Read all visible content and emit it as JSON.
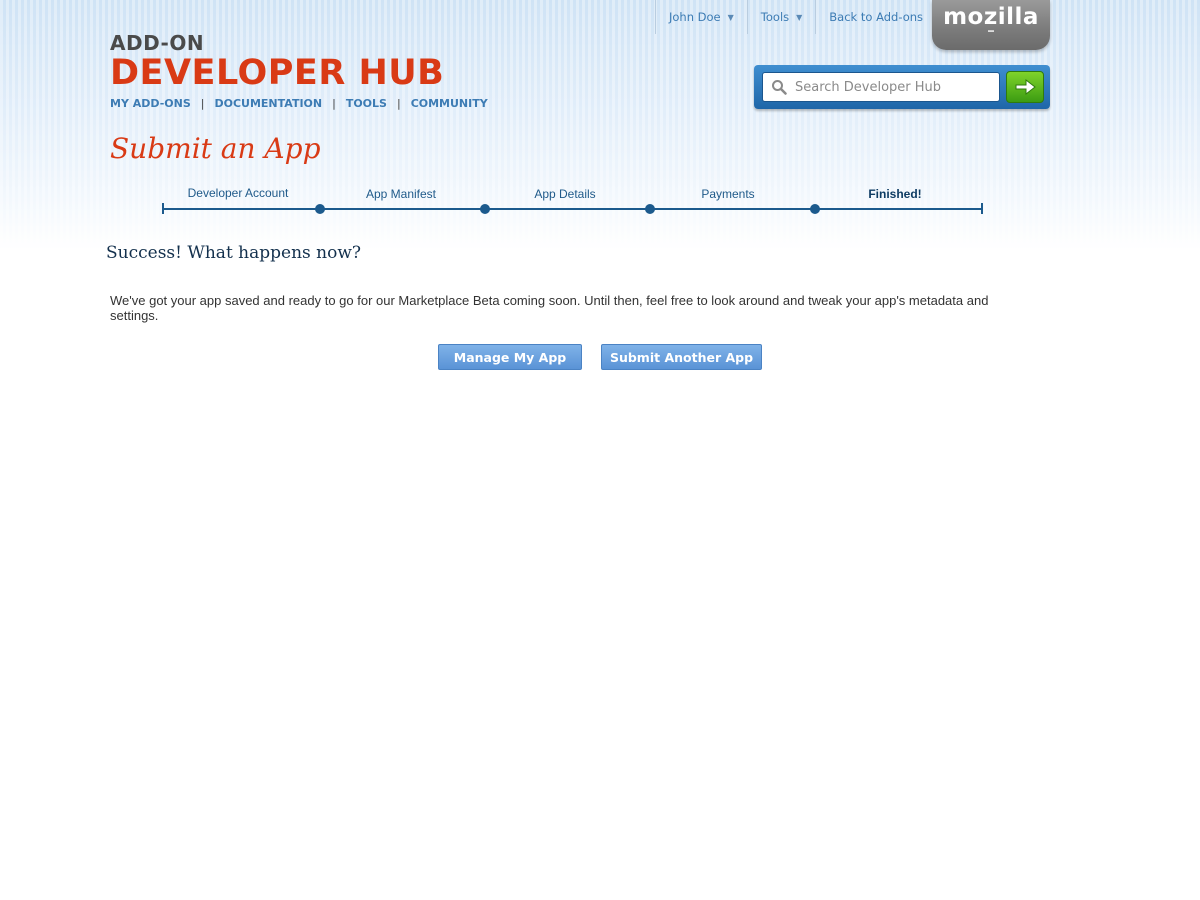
{
  "topnav": {
    "user": "John Doe",
    "tools": "Tools",
    "back": "Back to Add-ons",
    "brand": "mozilla"
  },
  "logo": {
    "line1": "ADD-ON",
    "line2": "DEVELOPER HUB"
  },
  "subnav": {
    "items": [
      "MY ADD-ONS",
      "DOCUMENTATION",
      "TOOLS",
      "COMMUNITY"
    ],
    "separator": "|"
  },
  "search": {
    "placeholder": "Search Developer Hub"
  },
  "page": {
    "title": "Submit an App"
  },
  "progress": {
    "steps": [
      "Developer Account",
      "App Manifest",
      "App Details",
      "Payments",
      "Finished!"
    ],
    "current_step": "Finished!"
  },
  "content": {
    "heading": "Success! What happens now?",
    "body": "We've got your app saved and ready to go for our Marketplace Beta coming soon. Until then, feel free to look around and tweak your app's metadata and settings.",
    "primary_button": "Manage My App",
    "secondary_button": "Submit Another App"
  },
  "colors": {
    "brand_orange": "#d93a15",
    "link_blue": "#3d7cb4",
    "progress_blue": "#1c5a8d",
    "button_blue": "#6aa3df",
    "go_green": "#4caf1a"
  }
}
